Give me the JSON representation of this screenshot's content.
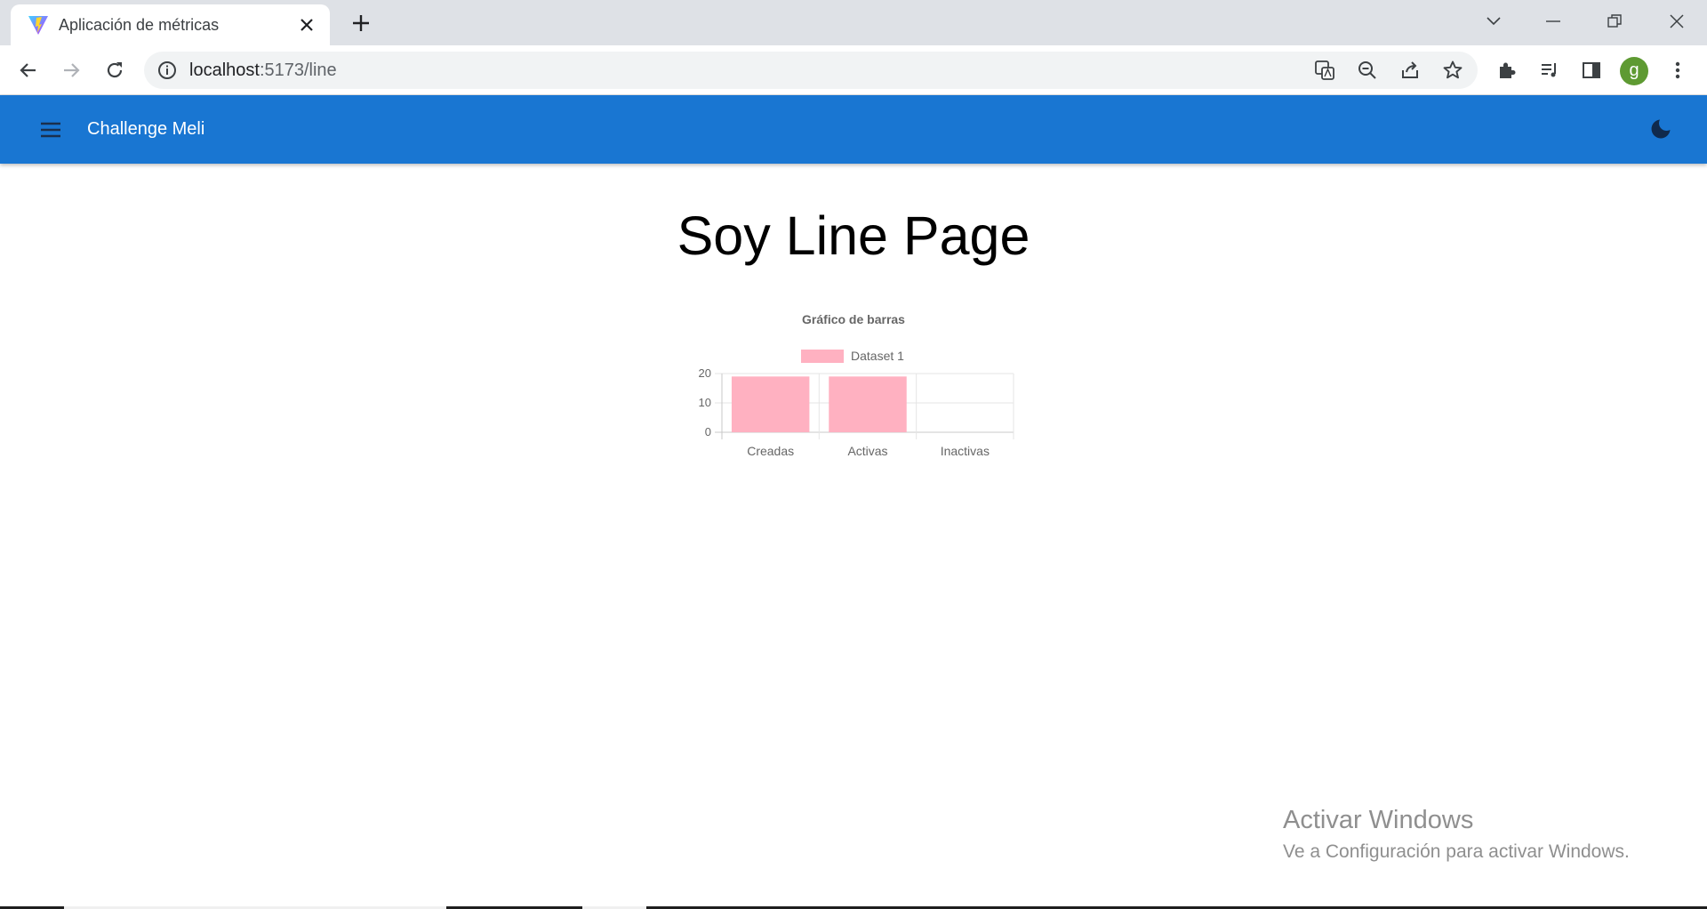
{
  "browser": {
    "tab_title": "Aplicación de métricas",
    "url_host": "localhost",
    "url_path": ":5173/line",
    "profile_initial": "g"
  },
  "app": {
    "title": "Challenge Meli",
    "primary_color": "#1976d2",
    "menu_icon": "hamburger-menu-icon",
    "theme_icon": "dark-mode-moon-icon"
  },
  "page": {
    "heading": "Soy Line Page"
  },
  "chart_data": {
    "type": "bar",
    "title": "Gráfico de barras",
    "categories": [
      "Creadas",
      "Activas",
      "Inactivas"
    ],
    "series": [
      {
        "name": "Dataset 1",
        "values": [
          19,
          19,
          0
        ],
        "color": "#ffb1c1",
        "border": "#ff6384"
      }
    ],
    "ylim": [
      0,
      20
    ],
    "yticks": [
      0,
      10,
      20
    ],
    "grid": true,
    "legend": "top"
  },
  "watermark": {
    "line1": "Activar Windows",
    "line2": "Ve a Configuración para activar Windows."
  }
}
